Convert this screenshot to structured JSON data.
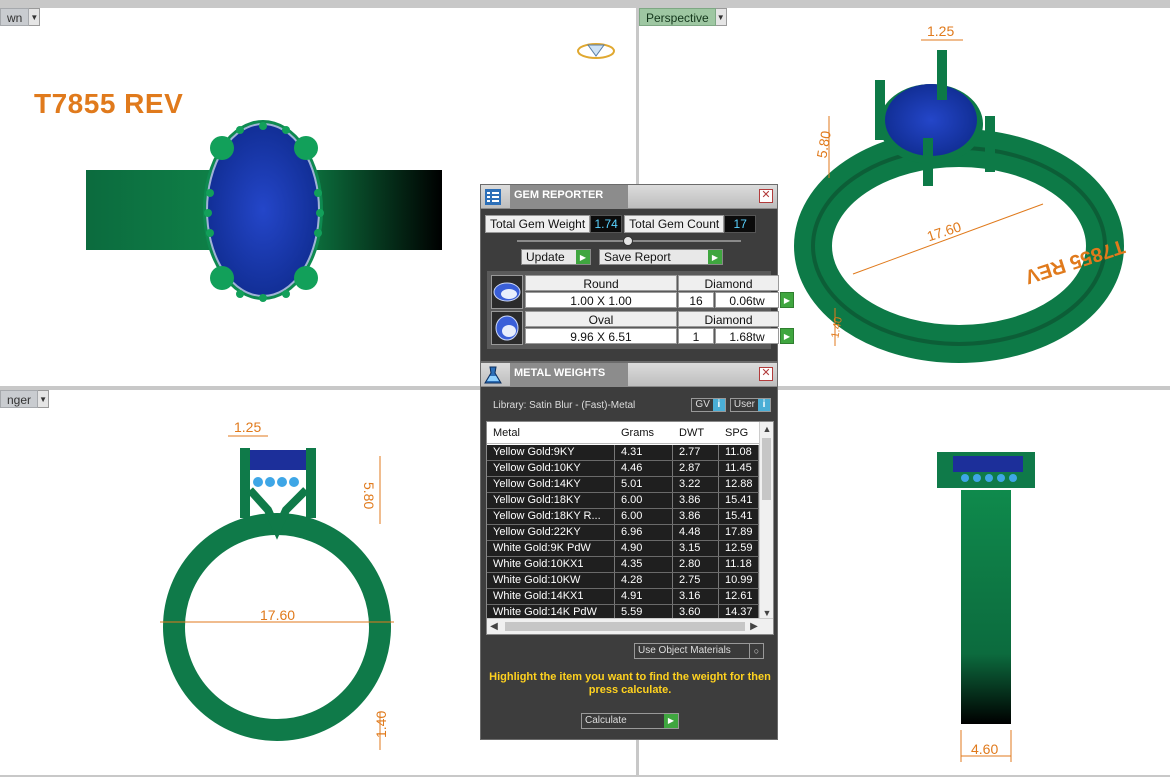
{
  "viewports": {
    "top_left": {
      "tab": "wn",
      "title": "T7855 REV"
    },
    "top_right": {
      "tab": "Perspective",
      "engraving": "T7855 REV"
    },
    "bottom_left": {
      "tab": "nger"
    }
  },
  "dimensions": {
    "prong_width": "1.25",
    "stone_height": "5.80",
    "ring_diameter": "17.60",
    "band_thickness": "1.40",
    "shank_width": "4.60",
    "side_mark": "1.40"
  },
  "gem_reporter": {
    "title": "GEM REPORTER",
    "total_weight_label": "Total Gem Weight",
    "total_weight_value": "1.74",
    "total_count_label": "Total Gem Count",
    "total_count_value": "17",
    "update_label": "Update",
    "save_label": "Save Report",
    "gems": [
      {
        "shape": "Round",
        "size": "1.00 X 1.00",
        "material": "Diamond",
        "qty": "16",
        "weight": "0.06tw"
      },
      {
        "shape": "Oval",
        "size": "9.96 X 6.51",
        "material": "Diamond",
        "qty": "1",
        "weight": "1.68tw"
      }
    ]
  },
  "metal_weights": {
    "title": "METAL WEIGHTS",
    "library": "Library: Satin Blur - (Fast)-Metal",
    "gv_label": "GV",
    "user_label": "User",
    "info_glyph": "i",
    "columns": [
      "Metal",
      "Grams",
      "DWT",
      "SPG"
    ],
    "rows": [
      [
        "Yellow Gold:9KY",
        "4.31",
        "2.77",
        "11.08"
      ],
      [
        "Yellow Gold:10KY",
        "4.46",
        "2.87",
        "11.45"
      ],
      [
        "Yellow Gold:14KY",
        "5.01",
        "3.22",
        "12.88"
      ],
      [
        "Yellow Gold:18KY",
        "6.00",
        "3.86",
        "15.41"
      ],
      [
        "Yellow Gold:18KY R...",
        "6.00",
        "3.86",
        "15.41"
      ],
      [
        "Yellow Gold:22KY",
        "6.96",
        "4.48",
        "17.89"
      ],
      [
        "White Gold:9K PdW",
        "4.90",
        "3.15",
        "12.59"
      ],
      [
        "White Gold:10KX1",
        "4.35",
        "2.80",
        "11.18"
      ],
      [
        "White Gold:10KW",
        "4.28",
        "2.75",
        "10.99"
      ],
      [
        "White Gold:14KX1",
        "4.91",
        "3.16",
        "12.61"
      ],
      [
        "White Gold:14K PdW",
        "5.59",
        "3.60",
        "14.37"
      ]
    ],
    "use_object_materials": "Use Object Materials",
    "hint": "Highlight the item you want to find the weight for then press calculate.",
    "calculate_label": "Calculate"
  }
}
